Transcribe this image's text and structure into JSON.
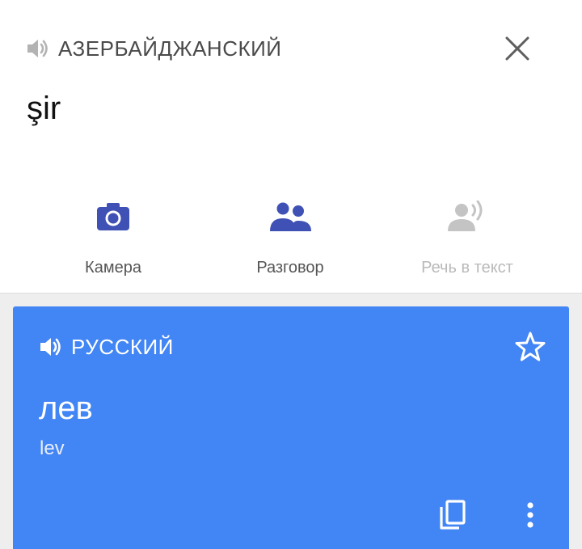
{
  "colors": {
    "accent": "#3f51b5",
    "card": "#4285f4",
    "disabled": "#b9b9b9"
  },
  "source": {
    "language": "АЗЕРБАЙДЖАНСКИЙ",
    "text": "şir",
    "speaker_icon": "speaker-icon",
    "close_icon": "close-icon"
  },
  "tools": [
    {
      "label": "Камера",
      "icon": "camera-icon",
      "enabled": true
    },
    {
      "label": "Разговор",
      "icon": "conversation-icon",
      "enabled": true
    },
    {
      "label": "Речь в текст",
      "icon": "transcribe-icon",
      "enabled": false
    }
  ],
  "result": {
    "language": "РУССКИЙ",
    "text": "лев",
    "transliteration": "lev",
    "star_icon": "star-outline-icon",
    "copy_icon": "copy-icon",
    "more_icon": "more-vert-icon"
  }
}
